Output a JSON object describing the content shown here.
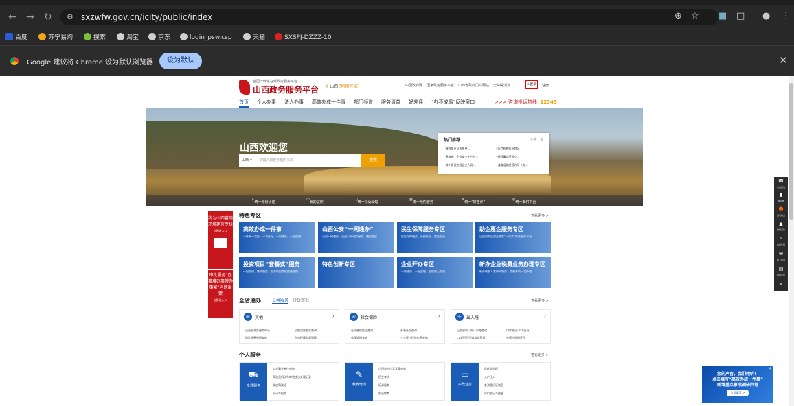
{
  "browser": {
    "url": "sxzwfw.gov.cn/icity/public/index",
    "bookmarks": [
      "百度",
      "苏宁易购",
      "搜索",
      "淘宝",
      "京东",
      "login_psw.csp",
      "天猫",
      "SXSPJ-DZZZ-10"
    ],
    "infobar": {
      "message": "Google 建议将 Chrome 设为默认浏览器",
      "button": "设为默认"
    }
  },
  "site": {
    "logo_sub": "全国一体化在线政务服务平台",
    "logo_title": "山西政务服务平台",
    "location": "山西",
    "location_switch": "[切换区域]",
    "top_links": [
      "中国政府网",
      "国家政务服务平台",
      "山西省政府门户网站",
      "无障碍浏览"
    ],
    "login": "登录",
    "register": "注册",
    "nav": [
      "首页",
      "个人办事",
      "法人办事",
      "高效办成一件事",
      "部门频道",
      "服务清单",
      "好差评",
      "“办不成事”反映窗口"
    ],
    "hotline_label": ">>> 咨询投诉热线:",
    "hotline_number": "12345"
  },
  "banner": {
    "welcome": "山西欢迎您",
    "region": "山西",
    "search_placeholder": "请输入您要办理的事项",
    "search_button": "搜索",
    "hot_title": "热门推荐",
    "hot_more": "换一批",
    "hot_items": [
      "· 律师执业证书变更...",
      "· 医疗机构执业登记",
      "· 建筑施工企业安全生产许...",
      "· 律师事务所设立...",
      "· 城乡建设工程企业人员...",
      "· 道路运输经营许可（货..."
    ],
    "quick": [
      "统一身份认证",
      "我的证照",
      "统一投诉受理",
      "统一预约服务",
      "统一“好差评”",
      "统一支付平台"
    ]
  },
  "promo": {
    "p1_title": "我为山西营商环境建言专栏",
    "p1_btn": "立即进入 >",
    "p2_title": "审批服务“办事难办事慢办事繁”问题反馈",
    "p2_btn": "立即进入 >"
  },
  "featured": {
    "title": "特色专区",
    "more": "查看更多 >",
    "cards": [
      {
        "title": "高效办成一件事",
        "desc": "一件事一次办，一次办好，一网通办，一窗受理"
      },
      {
        "title": "山西公安“一网通办”",
        "desc": "公安一网通办，山西公安政务服务，便民惠民"
      },
      {
        "title": "民生保障服务专区",
        "desc": "民生保障服务，社保医保，就业创业"
      },
      {
        "title": "助企惠企服务专区",
        "desc": "山西省助企惠企政策“一站式”综合服务平台"
      },
      {
        "title": "投资项目“套餐式”服务",
        "desc": "一窗受理，集成服务，投资项目审批提速增效"
      },
      {
        "title": "特色创新专区",
        "desc": ""
      },
      {
        "title": "企业开办专区",
        "desc": "一网通办，一窗受理，全程网上办理"
      },
      {
        "title": "新办企业税费业务办理专区",
        "desc": "新办纳税人套餐式服务，涉税事项一次办理"
      }
    ]
  },
  "province": {
    "title": "全省通办",
    "tab_public": "公共服务",
    "tab_admin": "行政审批",
    "more": "查看更多 >",
    "boxes": [
      {
        "name": "其他",
        "items": [
          "山西省政务服务中心...",
          "抗震设防要求查询",
          "风险隐患举报查询",
          "生态环境监督管理"
        ]
      },
      {
        "name": "社会保险",
        "items": [
          "社保缴纳凭证查询",
          "养老社保查询",
          "参保证明查询",
          "个人医疗保险信息查询"
        ]
      },
      {
        "name": "出入境",
        "items": [
          "山西省内（外）户籍查询",
          "口岸签证-个人签证",
          "口岸签证-团体旅游签证",
          "外国人居留证件"
        ]
      }
    ]
  },
  "personal": {
    "title": "个人服务",
    "more": "查看更多 >",
    "boxes": [
      {
        "name": "交通服务",
        "items": [
          "公共事业单位查询",
          "驾驶员机动车审验违法处理记录",
          "发放驾驶证",
          "机动车检验"
        ]
      },
      {
        "name": "教育培训",
        "items": [
          "山西省中小学学籍查询",
          "招生考试",
          "培训服务",
          "职业教育"
        ]
      },
      {
        "name": "户政业务",
        "items": [
          "居住证办理",
          "入户迁入",
          "查询身份证信息",
          "户口登记与变更"
        ]
      }
    ]
  },
  "toolbar": [
    {
      "icon": "☎",
      "label": "在线咨询"
    },
    {
      "icon": "▮",
      "label": "移动端"
    },
    {
      "icon": "☻",
      "label": "适老模式"
    },
    {
      "icon": "▲",
      "label": "智能问答"
    },
    {
      "icon": "⌕",
      "label": "在线反馈"
    },
    {
      "icon": "✉",
      "label": "网上投诉"
    },
    {
      "icon": "▤",
      "label": "我的评价"
    },
    {
      "icon": "»",
      "label": ""
    }
  ],
  "popup": {
    "line1": "您的声音，我们倾听！",
    "line2": "点击填写“高效办成一件事”",
    "line3": "新增重点事项调研问卷",
    "button": "立即填写 >"
  }
}
